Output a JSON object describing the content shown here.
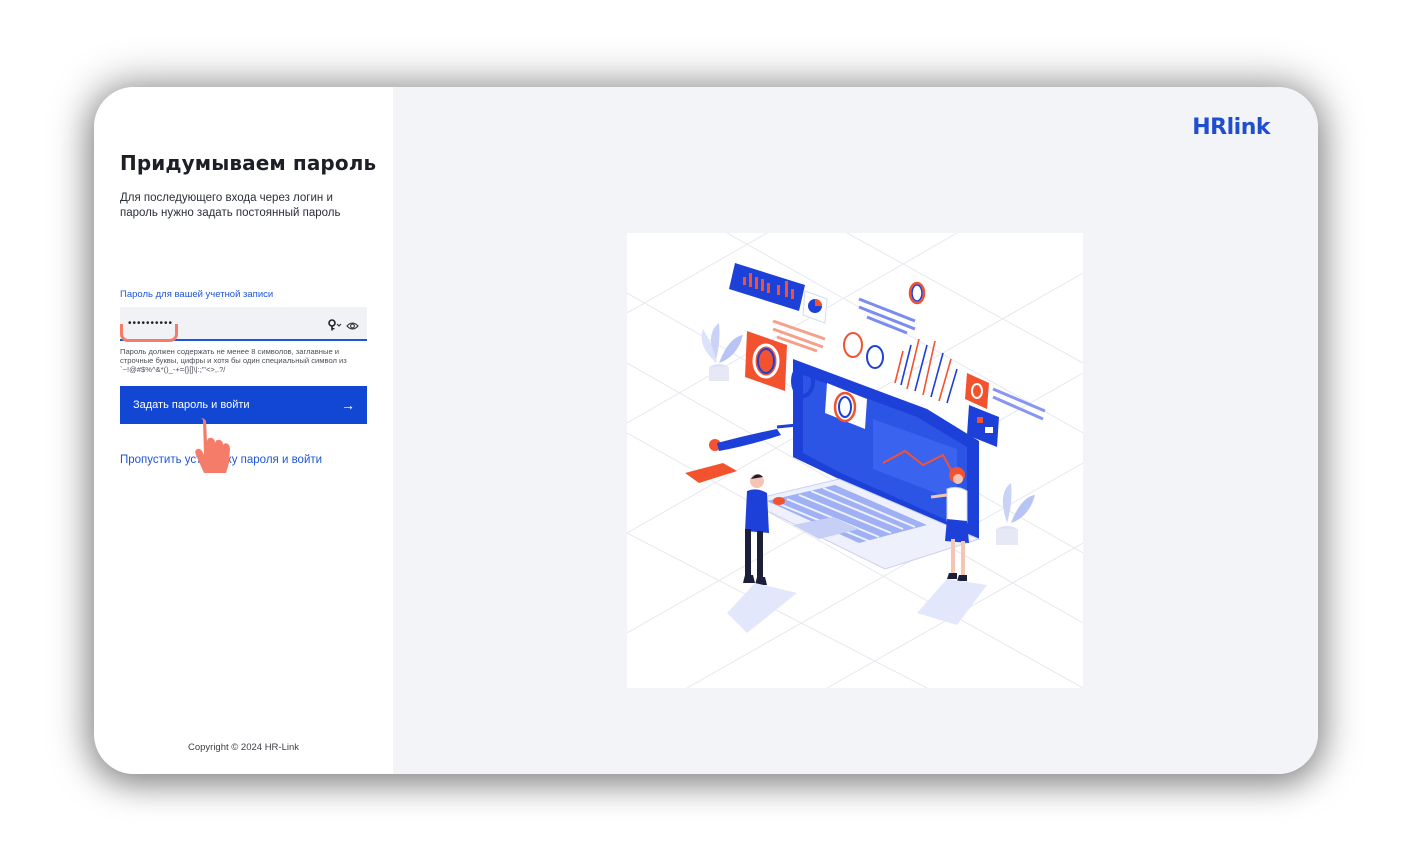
{
  "left_panel": {
    "title": "Придумываем пароль",
    "subtitle": "Для последующего входа через логин и пароль нужно задать постоянный пароль",
    "password_label": "Пароль для вашей учетной записи",
    "password_value": "••••••••••",
    "password_hint": "Пароль должен содержать не менее 8 символов, заглавные и строчные буквы, цифры и хотя бы один специальный символ из `~!@#$%^&*()_-+={}[]\\|:;\"'<>,.?/",
    "submit_label": "Задать пароль и войти",
    "submit_arrow": "→",
    "skip_label": "Пропустить установку пароля и войти",
    "copyright": "Copyright © 2024 HR-Link"
  },
  "right_panel": {
    "logo": "HRlink"
  },
  "icons": {
    "key": "key-icon",
    "eye": "eye-icon",
    "arrow": "arrow-right-icon",
    "cursor": "hand-pointer-icon"
  },
  "colors": {
    "accent": "#1147d3",
    "link": "#1f55d6",
    "highlight": "#f47d6a",
    "background": "#f2f4f8"
  }
}
